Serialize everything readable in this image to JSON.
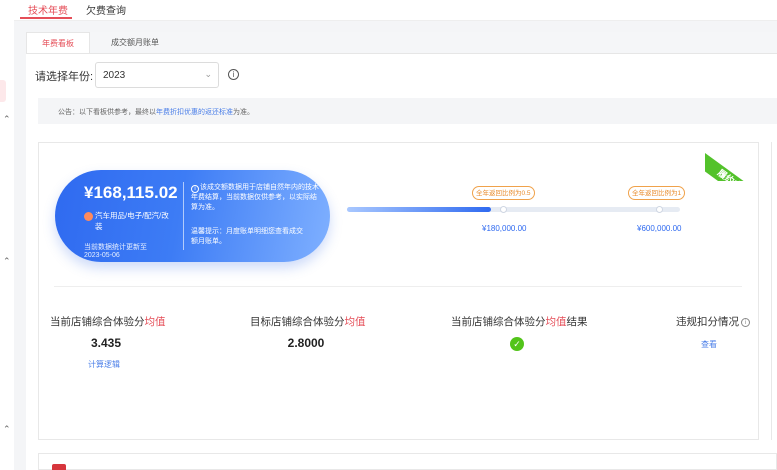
{
  "top_tabs": [
    {
      "label": "技术年费",
      "active": true
    },
    {
      "label": "欠费查询",
      "active": false
    }
  ],
  "sub_tabs": [
    {
      "label": "年费看板",
      "active": true
    },
    {
      "label": "成交额月账单",
      "active": false
    }
  ],
  "year_filter": {
    "label": "请选择年份:",
    "value": "2023"
  },
  "notice": {
    "prefix": "公告：以下看板供参考，最终以",
    "link": "年费折扣优惠的返还标准",
    "suffix": "为准。"
  },
  "summary": {
    "amount": "¥168,115.02",
    "category": "汽车用品/电子/配汽/改装",
    "update_text": "当前数据统计更新至",
    "update_date": "2023-05-06",
    "info_text": "该成交额数据用于店铺自然年内的技术年费结算，当前数据仅供参考，以实际结算为准。",
    "tip_text": "温馨提示：月度账单明细您查看成交额月账单。"
  },
  "ribbon": {
    "label": "履约中"
  },
  "progress": {
    "fraction_to_first": 0.49,
    "milestones": [
      {
        "tag": "全年返回比例为0.5",
        "value": "¥180,000.00"
      },
      {
        "tag": "全年返回比例为1",
        "value": "¥600,000.00"
      }
    ]
  },
  "metrics": [
    {
      "title_prefix": "当前店铺综合体验分",
      "title_highlight": "均值",
      "title_suffix": "",
      "value": "3.435",
      "link": "计算逻辑"
    },
    {
      "title_prefix": "目标店铺综合体验分",
      "title_highlight": "均值",
      "title_suffix": "",
      "value": "2.8000"
    },
    {
      "title_prefix": "当前店铺综合体验分",
      "title_highlight": "均值",
      "title_suffix": "结果",
      "status": "pass"
    },
    {
      "title_prefix": "违规扣分情况",
      "link": "查看"
    }
  ],
  "colors": {
    "accent": "#e54e58",
    "primary_blue": "#2f6af0",
    "success": "#52c41a",
    "warning": "#f0a24b"
  },
  "icons": [
    "info-circle-icon",
    "chevron-down-icon",
    "check-circle-icon",
    "category-icon"
  ]
}
